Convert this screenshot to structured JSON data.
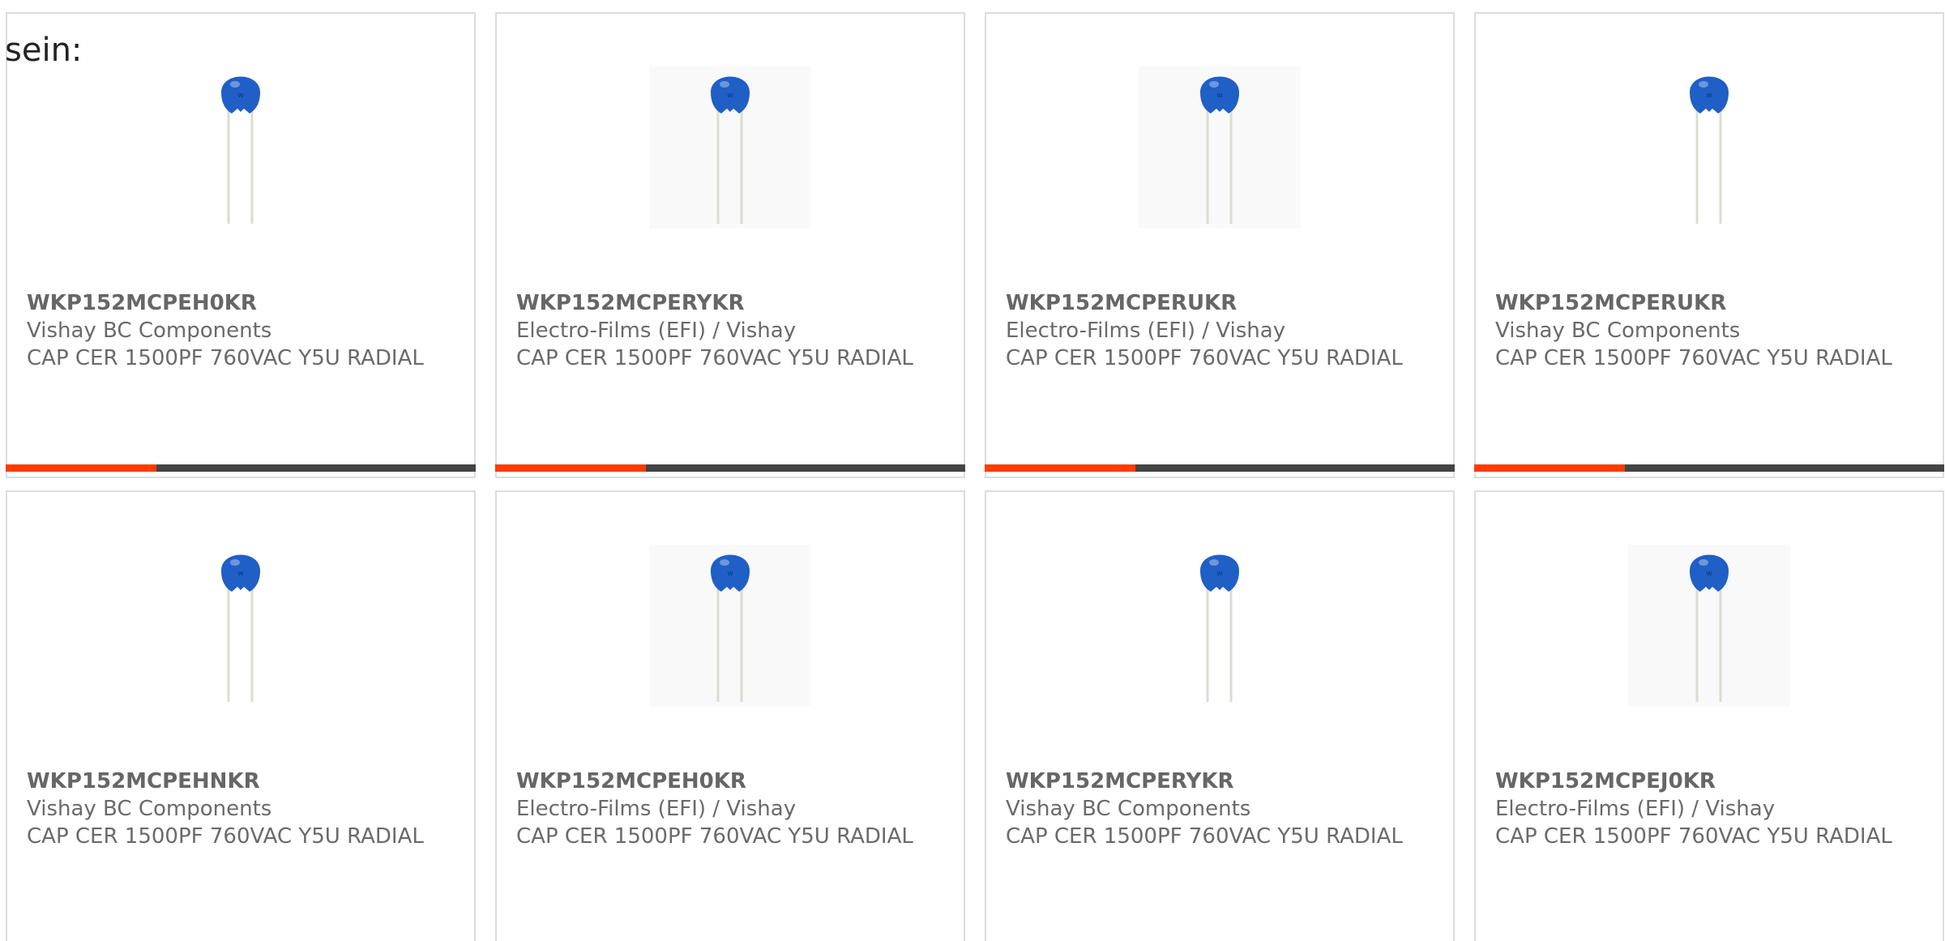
{
  "heading": "sein:",
  "colors": {
    "accent": "#ff3c00",
    "bar_track": "#444444",
    "capacitor_blue": "#1f5fc6"
  },
  "cards": [
    {
      "part_number": "WKP152MCPEH0KR",
      "manufacturer": "Vishay BC Components",
      "description": "CAP CER 1500PF 760VAC Y5U RADIAL",
      "image_icon": "ceramic-capacitor-icon",
      "progress": 0.32
    },
    {
      "part_number": "WKP152MCPERYKR",
      "manufacturer": "Electro-Films (EFI) / Vishay",
      "description": "CAP CER 1500PF 760VAC Y5U RADIAL",
      "image_icon": "ceramic-capacitor-icon",
      "progress": 0.32
    },
    {
      "part_number": "WKP152MCPERUKR",
      "manufacturer": "Electro-Films (EFI) / Vishay",
      "description": "CAP CER 1500PF 760VAC Y5U RADIAL",
      "image_icon": "ceramic-capacitor-icon",
      "progress": 0.32
    },
    {
      "part_number": "WKP152MCPERUKR",
      "manufacturer": "Vishay BC Components",
      "description": "CAP CER 1500PF 760VAC Y5U RADIAL",
      "image_icon": "ceramic-capacitor-icon",
      "progress": 0.32
    },
    {
      "part_number": "WKP152MCPEHNKR",
      "manufacturer": "Vishay BC Components",
      "description": "CAP CER 1500PF 760VAC Y5U RADIAL",
      "image_icon": "ceramic-capacitor-icon"
    },
    {
      "part_number": "WKP152MCPEH0KR",
      "manufacturer": "Electro-Films (EFI) / Vishay",
      "description": "CAP CER 1500PF 760VAC Y5U RADIAL",
      "image_icon": "ceramic-capacitor-icon"
    },
    {
      "part_number": "WKP152MCPERYKR",
      "manufacturer": "Vishay BC Components",
      "description": "CAP CER 1500PF 760VAC Y5U RADIAL",
      "image_icon": "ceramic-capacitor-icon"
    },
    {
      "part_number": "WKP152MCPEJ0KR",
      "manufacturer": "Electro-Films (EFI) / Vishay",
      "description": "CAP CER 1500PF 760VAC Y5U RADIAL",
      "image_icon": "ceramic-capacitor-icon"
    }
  ]
}
